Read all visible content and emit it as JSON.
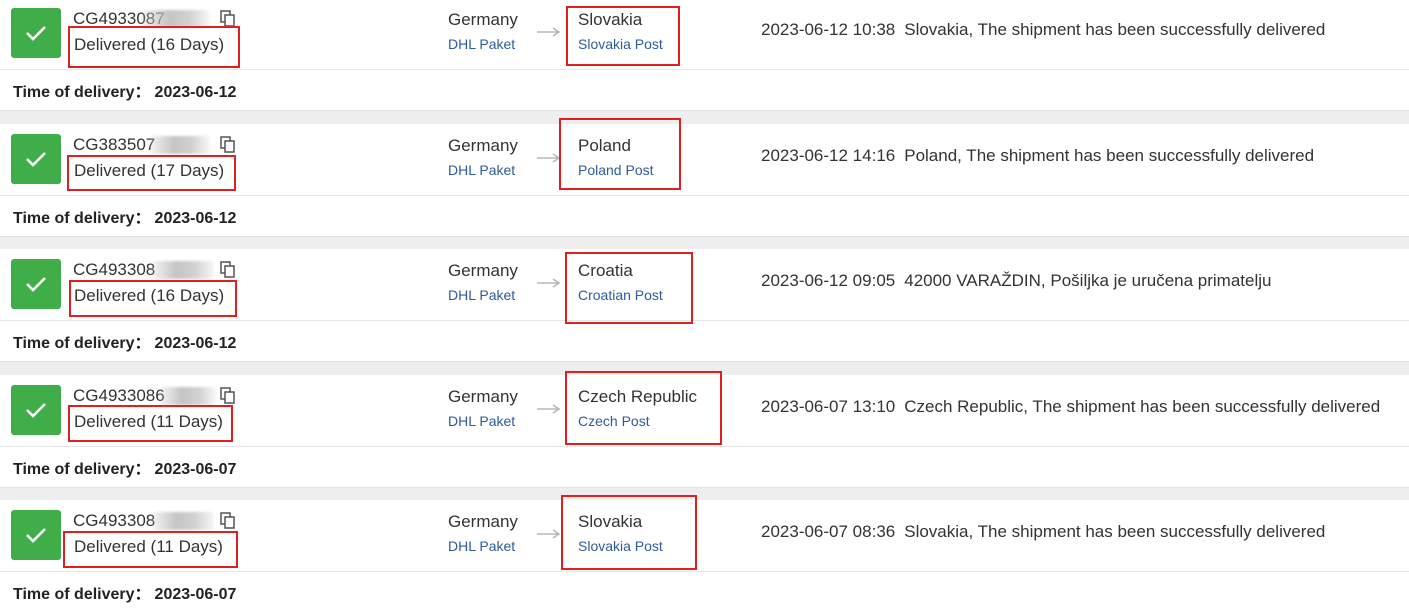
{
  "colors": {
    "accent_green": "#3fae49",
    "highlight_red": "#e0201f",
    "link_blue": "#2d5c9c"
  },
  "icons": {
    "status": "check-icon",
    "copy": "copy-icon",
    "arrow": "arrow-right-icon"
  },
  "shipments": [
    {
      "tracking": "CG4933087",
      "status": "Delivered (16 Days)",
      "origin_country": "Germany",
      "origin_carrier": "DHL Paket",
      "dest_country": "Slovakia",
      "dest_carrier": "Slovakia Post",
      "event_time": "2023-06-12 10:38",
      "event_text": "Slovakia, The shipment has been successfully delivered",
      "delivery_label": "Time of delivery：",
      "delivery_date": "2023-06-12"
    },
    {
      "tracking": "CG383507",
      "status": "Delivered (17 Days)",
      "origin_country": "Germany",
      "origin_carrier": "DHL Paket",
      "dest_country": "Poland",
      "dest_carrier": "Poland Post",
      "event_time": "2023-06-12 14:16",
      "event_text": "Poland, The shipment has been successfully delivered",
      "delivery_label": "Time of delivery：",
      "delivery_date": "2023-06-12"
    },
    {
      "tracking": "CG493308",
      "status": "Delivered (16 Days)",
      "origin_country": "Germany",
      "origin_carrier": "DHL Paket",
      "dest_country": "Croatia",
      "dest_carrier": "Croatian Post",
      "event_time": "2023-06-12 09:05",
      "event_text": "42000 VARAŽDIN, Pošiljka je uručena primatelju",
      "delivery_label": "Time of delivery：",
      "delivery_date": "2023-06-12"
    },
    {
      "tracking": "CG4933086",
      "status": "Delivered (11 Days)",
      "origin_country": "Germany",
      "origin_carrier": "DHL Paket",
      "dest_country": "Czech Republic",
      "dest_carrier": "Czech Post",
      "event_time": "2023-06-07 13:10",
      "event_text": "Czech Republic, The shipment has been successfully delivered",
      "delivery_label": "Time of delivery：",
      "delivery_date": "2023-06-07"
    },
    {
      "tracking": "CG493308",
      "status": "Delivered (11 Days)",
      "origin_country": "Germany",
      "origin_carrier": "DHL Paket",
      "dest_country": "Slovakia",
      "dest_carrier": "Slovakia Post",
      "event_time": "2023-06-07 08:36",
      "event_text": "Slovakia, The shipment has been successfully delivered",
      "delivery_label": "Time of delivery：",
      "delivery_date": "2023-06-07"
    }
  ]
}
